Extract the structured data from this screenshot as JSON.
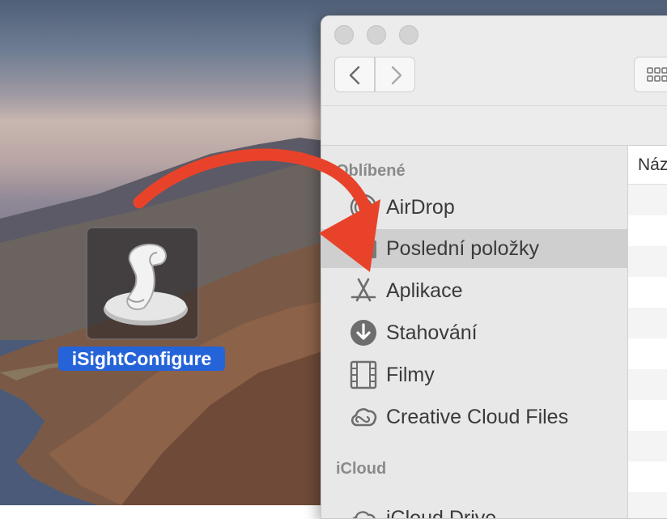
{
  "desktop": {
    "app_icon_label": "iSightConfigure"
  },
  "finder": {
    "column_header": "Náz",
    "sidebar": {
      "favorites_title": "Oblíbené",
      "items": [
        {
          "label": "AirDrop",
          "icon": "airdrop-icon"
        },
        {
          "label": "Poslední položky",
          "icon": "recents-icon",
          "selected": true
        },
        {
          "label": "Aplikace",
          "icon": "applications-icon"
        },
        {
          "label": "Stahování",
          "icon": "downloads-icon"
        },
        {
          "label": "Filmy",
          "icon": "movies-icon"
        },
        {
          "label": "Creative Cloud Files",
          "icon": "creative-cloud-icon"
        }
      ],
      "icloud_title": "iCloud",
      "icloud_items": [
        {
          "label": "iCloud Drive",
          "icon": "icloud-icon"
        }
      ]
    }
  },
  "colors": {
    "selection_blue": "#2563d8",
    "arrow_red": "#e8432a"
  }
}
